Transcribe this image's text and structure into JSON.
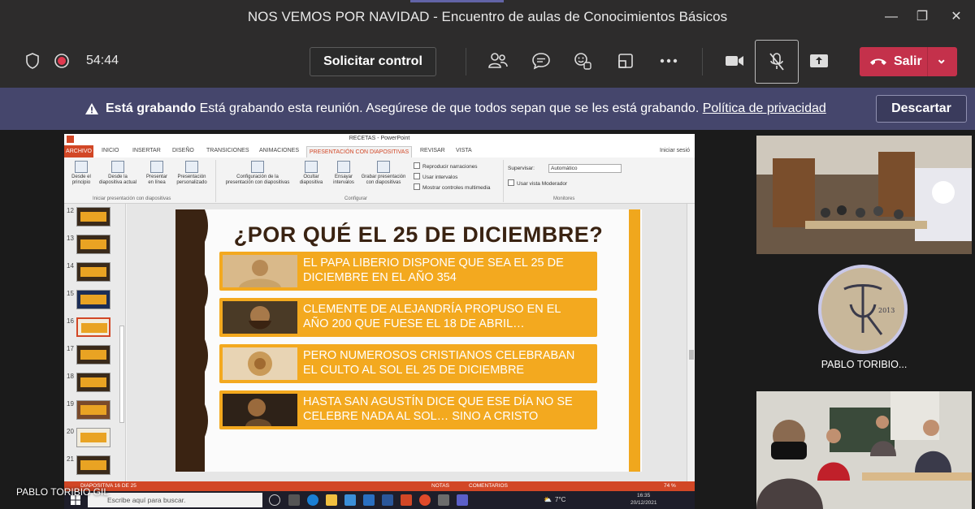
{
  "window": {
    "title": "NOS VEMOS POR NAVIDAD - Encuentro de aulas de Conocimientos Básicos",
    "minimize": "—",
    "maximize": "❐",
    "close": "✕"
  },
  "toolbar": {
    "timer": "54:44",
    "request_control_label": "Solicitar control",
    "leave_label": "Salir",
    "leave_color": "#c4314b"
  },
  "banner": {
    "heading": "Está grabando",
    "message": "Está grabando esta reunión. Asegúrese de que todos sepan que se les está grabando.",
    "privacy_link": "Política de privacidad",
    "dismiss_label": "Descartar",
    "background": "#45466c"
  },
  "shared_screen": {
    "presenter_name": "PABLO TORIBIO GIL",
    "app_title": "RECETAS - PowerPoint",
    "sign_in": "Iniciar sesió",
    "tabs": [
      "ARCHIVO",
      "INICIO",
      "INSERTAR",
      "DISEÑO",
      "TRANSICIONES",
      "ANIMACIONES",
      "PRESENTACIÓN CON DIAPOSITIVAS",
      "REVISAR",
      "VISTA"
    ],
    "ribbon": {
      "buttons": [
        {
          "label1": "Desde el",
          "label2": "principio"
        },
        {
          "label1": "Desde la",
          "label2": "diapositiva actual"
        },
        {
          "label1": "Presentar",
          "label2": "en línea"
        },
        {
          "label1": "Presentación",
          "label2": "personalizado"
        },
        {
          "label1": "Configuración de la",
          "label2": "presentación con diapositivas"
        },
        {
          "label1": "Ocultar",
          "label2": "diapositiva"
        },
        {
          "label1": "Ensayar",
          "label2": "intervalos"
        },
        {
          "label1": "Grabar presentación",
          "label2": "con diapositivas"
        }
      ],
      "checkboxes": [
        "Reproducir narraciones",
        "Usar intervalos",
        "Mostrar controles multimedia"
      ],
      "monitor_label": "Supervisar:",
      "monitor_value": "Automático",
      "presenter_view": "Usar vista Moderador",
      "groups": [
        "Iniciar presentación con diapositivas",
        "Configurar",
        "Monitores"
      ]
    },
    "thumbnails": [
      "12",
      "13",
      "14",
      "15",
      "16",
      "17",
      "18",
      "19",
      "20",
      "21"
    ],
    "selected_slide": "16",
    "slide": {
      "title": "¿POR QUÉ EL 25 DE DICIEMBRE?",
      "facts": [
        {
          "line1": "EL PAPA LIBERIO DISPONE QUE SEA EL 25 DE",
          "line2": "DICIEMBRE EN EL AÑO 354"
        },
        {
          "line1": "CLEMENTE DE ALEJANDRÍA PROPUSO EN EL",
          "line2": "AÑO 200 QUE FUESE EL 18 DE ABRIL…"
        },
        {
          "line1": "PERO NUMEROSOS CRISTIANOS CELEBRABAN",
          "line2": "EL CULTO AL SOL EL 25 DE DICIEMBRE"
        },
        {
          "line1": "HASTA SAN AGUSTÍN DICE QUE ESE DÍA NO SE",
          "line2": "CELEBRE NADA AL SOL… SINO A CRISTO"
        }
      ],
      "accent_color": "#f3a91f"
    },
    "status": {
      "slide_info": "DIAPOSITIVA 16 DE 25",
      "notes": "NOTAS",
      "comments": "COMENTARIOS",
      "zoom": "74 %"
    },
    "taskbar": {
      "search_placeholder": "Escribe aquí para buscar.",
      "weather": "7°C",
      "time": "16:35",
      "date": "20/12/2021"
    }
  },
  "participants": {
    "tile2_name": "PABLO TORIBIO...",
    "avatar_text": "2013"
  }
}
